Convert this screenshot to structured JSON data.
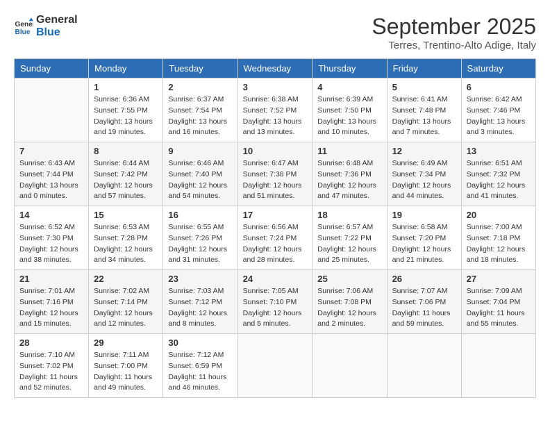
{
  "header": {
    "logo_line1": "General",
    "logo_line2": "Blue",
    "month": "September 2025",
    "location": "Terres, Trentino-Alto Adige, Italy"
  },
  "weekdays": [
    "Sunday",
    "Monday",
    "Tuesday",
    "Wednesday",
    "Thursday",
    "Friday",
    "Saturday"
  ],
  "weeks": [
    [
      {
        "day": "",
        "info": ""
      },
      {
        "day": "1",
        "info": "Sunrise: 6:36 AM\nSunset: 7:55 PM\nDaylight: 13 hours\nand 19 minutes."
      },
      {
        "day": "2",
        "info": "Sunrise: 6:37 AM\nSunset: 7:54 PM\nDaylight: 13 hours\nand 16 minutes."
      },
      {
        "day": "3",
        "info": "Sunrise: 6:38 AM\nSunset: 7:52 PM\nDaylight: 13 hours\nand 13 minutes."
      },
      {
        "day": "4",
        "info": "Sunrise: 6:39 AM\nSunset: 7:50 PM\nDaylight: 13 hours\nand 10 minutes."
      },
      {
        "day": "5",
        "info": "Sunrise: 6:41 AM\nSunset: 7:48 PM\nDaylight: 13 hours\nand 7 minutes."
      },
      {
        "day": "6",
        "info": "Sunrise: 6:42 AM\nSunset: 7:46 PM\nDaylight: 13 hours\nand 3 minutes."
      }
    ],
    [
      {
        "day": "7",
        "info": "Sunrise: 6:43 AM\nSunset: 7:44 PM\nDaylight: 13 hours\nand 0 minutes."
      },
      {
        "day": "8",
        "info": "Sunrise: 6:44 AM\nSunset: 7:42 PM\nDaylight: 12 hours\nand 57 minutes."
      },
      {
        "day": "9",
        "info": "Sunrise: 6:46 AM\nSunset: 7:40 PM\nDaylight: 12 hours\nand 54 minutes."
      },
      {
        "day": "10",
        "info": "Sunrise: 6:47 AM\nSunset: 7:38 PM\nDaylight: 12 hours\nand 51 minutes."
      },
      {
        "day": "11",
        "info": "Sunrise: 6:48 AM\nSunset: 7:36 PM\nDaylight: 12 hours\nand 47 minutes."
      },
      {
        "day": "12",
        "info": "Sunrise: 6:49 AM\nSunset: 7:34 PM\nDaylight: 12 hours\nand 44 minutes."
      },
      {
        "day": "13",
        "info": "Sunrise: 6:51 AM\nSunset: 7:32 PM\nDaylight: 12 hours\nand 41 minutes."
      }
    ],
    [
      {
        "day": "14",
        "info": "Sunrise: 6:52 AM\nSunset: 7:30 PM\nDaylight: 12 hours\nand 38 minutes."
      },
      {
        "day": "15",
        "info": "Sunrise: 6:53 AM\nSunset: 7:28 PM\nDaylight: 12 hours\nand 34 minutes."
      },
      {
        "day": "16",
        "info": "Sunrise: 6:55 AM\nSunset: 7:26 PM\nDaylight: 12 hours\nand 31 minutes."
      },
      {
        "day": "17",
        "info": "Sunrise: 6:56 AM\nSunset: 7:24 PM\nDaylight: 12 hours\nand 28 minutes."
      },
      {
        "day": "18",
        "info": "Sunrise: 6:57 AM\nSunset: 7:22 PM\nDaylight: 12 hours\nand 25 minutes."
      },
      {
        "day": "19",
        "info": "Sunrise: 6:58 AM\nSunset: 7:20 PM\nDaylight: 12 hours\nand 21 minutes."
      },
      {
        "day": "20",
        "info": "Sunrise: 7:00 AM\nSunset: 7:18 PM\nDaylight: 12 hours\nand 18 minutes."
      }
    ],
    [
      {
        "day": "21",
        "info": "Sunrise: 7:01 AM\nSunset: 7:16 PM\nDaylight: 12 hours\nand 15 minutes."
      },
      {
        "day": "22",
        "info": "Sunrise: 7:02 AM\nSunset: 7:14 PM\nDaylight: 12 hours\nand 12 minutes."
      },
      {
        "day": "23",
        "info": "Sunrise: 7:03 AM\nSunset: 7:12 PM\nDaylight: 12 hours\nand 8 minutes."
      },
      {
        "day": "24",
        "info": "Sunrise: 7:05 AM\nSunset: 7:10 PM\nDaylight: 12 hours\nand 5 minutes."
      },
      {
        "day": "25",
        "info": "Sunrise: 7:06 AM\nSunset: 7:08 PM\nDaylight: 12 hours\nand 2 minutes."
      },
      {
        "day": "26",
        "info": "Sunrise: 7:07 AM\nSunset: 7:06 PM\nDaylight: 11 hours\nand 59 minutes."
      },
      {
        "day": "27",
        "info": "Sunrise: 7:09 AM\nSunset: 7:04 PM\nDaylight: 11 hours\nand 55 minutes."
      }
    ],
    [
      {
        "day": "28",
        "info": "Sunrise: 7:10 AM\nSunset: 7:02 PM\nDaylight: 11 hours\nand 52 minutes."
      },
      {
        "day": "29",
        "info": "Sunrise: 7:11 AM\nSunset: 7:00 PM\nDaylight: 11 hours\nand 49 minutes."
      },
      {
        "day": "30",
        "info": "Sunrise: 7:12 AM\nSunset: 6:59 PM\nDaylight: 11 hours\nand 46 minutes."
      },
      {
        "day": "",
        "info": ""
      },
      {
        "day": "",
        "info": ""
      },
      {
        "day": "",
        "info": ""
      },
      {
        "day": "",
        "info": ""
      }
    ]
  ]
}
